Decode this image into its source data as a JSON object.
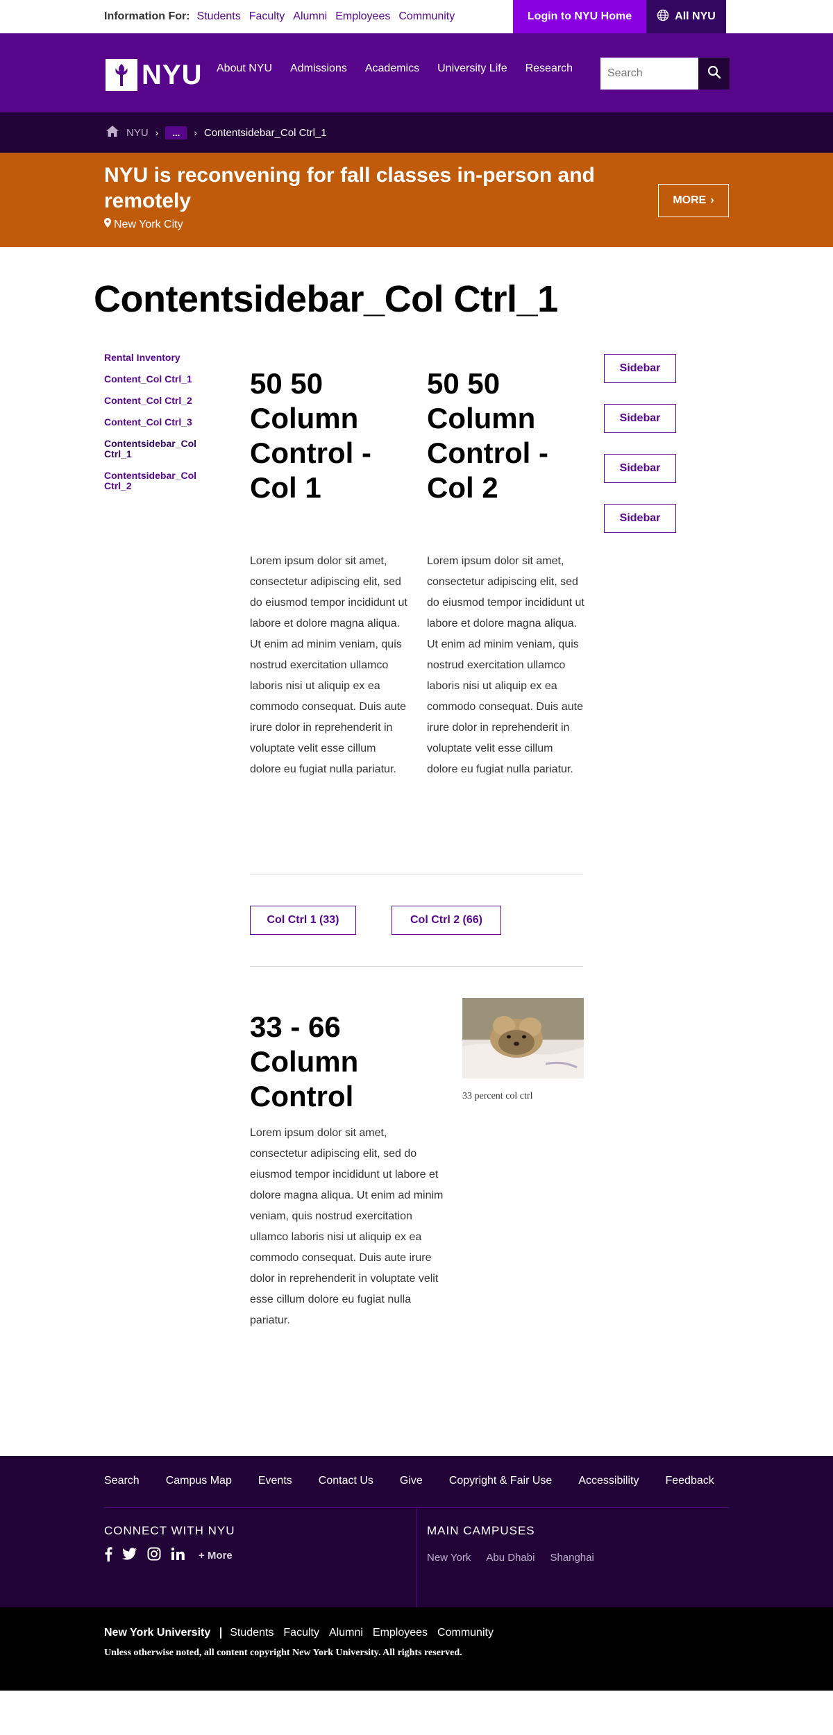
{
  "topbar": {
    "info_label": "Information For:",
    "audiences": [
      "Students",
      "Faculty",
      "Alumni",
      "Employees",
      "Community"
    ],
    "login_label": "Login to NYU Home",
    "all_nyu_label": "All NYU"
  },
  "header": {
    "logo_text": "NYU",
    "nav": [
      "About NYU",
      "Admissions",
      "Academics",
      "University Life",
      "Research"
    ],
    "search_placeholder": "Search"
  },
  "breadcrumb": {
    "root": "NYU",
    "ellipsis": "...",
    "current": "Contentsidebar_Col Ctrl_1"
  },
  "alert": {
    "title": "NYU is reconvening for fall classes in-person and remotely",
    "location": "New York City",
    "more_label": "MORE"
  },
  "page": {
    "title": "Contentsidebar_Col Ctrl_1"
  },
  "sidenav": {
    "items": [
      "Rental Inventory",
      "Content_Col Ctrl_1",
      "Content_Col Ctrl_2",
      "Content_Col Ctrl_3",
      "Contentsidebar_Col Ctrl_1",
      "Contentsidebar_Col Ctrl_2"
    ]
  },
  "columns": {
    "col1_heading": "50 50 Column Control - Col 1",
    "col2_heading": "50 50 Column Control - Col 2",
    "lorem": "Lorem ipsum dolor sit amet, consectetur adipiscing elit, sed do eiusmod tempor incididunt ut labore et dolore magna aliqua. Ut enim ad minim veniam, quis nostrud exercitation ullamco laboris nisi ut aliquip ex ea commodo consequat. Duis aute irure dolor in reprehenderit in voluptate velit esse cillum dolore eu fugiat nulla pariatur."
  },
  "sidebar": {
    "buttons": [
      "Sidebar",
      "Sidebar",
      "Sidebar",
      "Sidebar"
    ]
  },
  "tabs": {
    "tab1": "Col Ctrl 1 (33)",
    "tab2": "Col Ctrl 2 (66)"
  },
  "section33": {
    "heading": "33 - 66 Column Control",
    "body": "Lorem ipsum dolor sit amet, consectetur adipiscing elit, sed do eiusmod tempor incididunt ut labore et dolore magna aliqua. Ut enim ad minim veniam, quis nostrud exercitation ullamco laboris nisi ut aliquip ex ea commodo consequat. Duis aute irure dolor in reprehenderit in voluptate velit esse cillum dolore eu fugiat nulla pariatur.",
    "caption": "33 percent col ctrl"
  },
  "footer": {
    "links": [
      "Search",
      "Campus Map",
      "Events",
      "Contact Us",
      "Give",
      "Copyright & Fair Use",
      "Accessibility",
      "Feedback"
    ],
    "connect_heading": "CONNECT WITH NYU",
    "more_social": "+ More",
    "campus_heading": "MAIN CAMPUSES",
    "campuses": [
      "New York",
      "Abu Dhabi",
      "Shanghai"
    ]
  },
  "bottom": {
    "university": "New York University",
    "links": [
      "Students",
      "Faculty",
      "Alumni",
      "Employees",
      "Community"
    ],
    "copyright": "Unless otherwise noted, all content copyright New York University. All rights reserved."
  },
  "colors": {
    "nyu_purple": "#57068c",
    "dark_purple": "#220337",
    "bright_purple": "#8900e1",
    "alert_orange": "#c05b0c"
  }
}
